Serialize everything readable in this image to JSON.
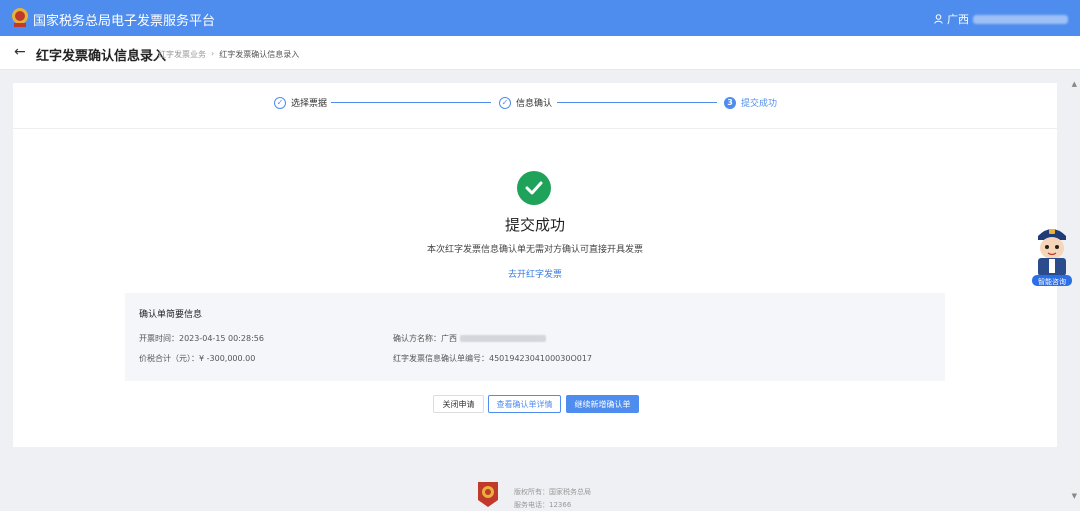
{
  "header": {
    "app_title": "国家税务总局电子发票服务平台",
    "user_label": "广西",
    "colors": {
      "brand": "#4e8cee",
      "success": "#1fa25a"
    }
  },
  "page": {
    "back_icon": "arrow-left-icon",
    "title": "红字发票确认信息录入",
    "breadcrumb": [
      "红字发票业务",
      "红字发票确认信息录入"
    ]
  },
  "steps": [
    {
      "label": "选择票据",
      "state": "done"
    },
    {
      "label": "信息确认",
      "state": "done"
    },
    {
      "label": "提交成功",
      "state": "current",
      "number": "3"
    }
  ],
  "result": {
    "title": "提交成功",
    "description": "本次红字发票信息确认单无需对方确认可直接开具发票",
    "link": "去开红字发票"
  },
  "summary": {
    "title": "确认单简要信息",
    "issue_time_label": "开票时间：",
    "issue_time": "2023-04-15 00:28:56",
    "total_label": "价税合计（元）：",
    "total": "¥ -300,000.00",
    "confirmer_label": "确认方名称：",
    "confirmer_value": "广西",
    "number_label": "红字发票信息确认单编号：",
    "number": "4501942304100030O017"
  },
  "actions": {
    "close": "关闭申请",
    "view_detail": "查看确认单详情",
    "continue_new": "继续新增确认单"
  },
  "footer": {
    "copyright": "版权所有：国家税务总局",
    "phone": "服务电话：12366"
  },
  "assistant": {
    "label": "智能咨询"
  }
}
